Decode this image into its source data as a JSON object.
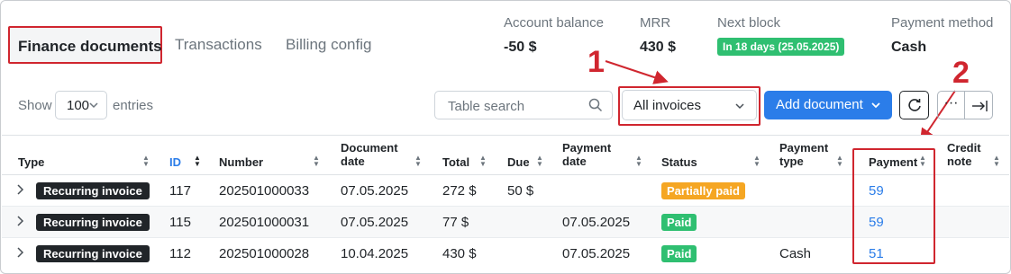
{
  "tabs": [
    {
      "label": "Finance documents",
      "active": true
    },
    {
      "label": "Transactions",
      "active": false
    },
    {
      "label": "Billing config",
      "active": false
    }
  ],
  "summary": {
    "account_balance_label": "Account balance",
    "account_balance_value": "-50 $",
    "mrr_label": "MRR",
    "mrr_value": "430 $",
    "next_block_label": "Next block",
    "next_block_value": "In 18 days (25.05.2025)",
    "payment_method_label": "Payment method",
    "payment_method_value": "Cash"
  },
  "annotations": {
    "one": "1",
    "two": "2"
  },
  "controls": {
    "show_label": "Show",
    "entries_value": "100",
    "entries_label": "entries",
    "search_placeholder": "Table search",
    "filter_value": "All invoices",
    "add_document_label": "Add document",
    "more_label": "···"
  },
  "table": {
    "headers": {
      "type": "Type",
      "id": "ID",
      "number": "Number",
      "document_date_1": "Document",
      "document_date_2": "date",
      "total": "Total",
      "due": "Due",
      "payment_date_1": "Payment",
      "payment_date_2": "date",
      "status": "Status",
      "payment_type_1": "Payment",
      "payment_type_2": "type",
      "payment": "Payment",
      "credit_note_1": "Credit",
      "credit_note_2": "note"
    },
    "rows": [
      {
        "type": "Recurring invoice",
        "id": "117",
        "number": "202501000033",
        "document_date": "07.05.2025",
        "total": "272 $",
        "due": "50 $",
        "payment_date": "",
        "status": "Partially paid",
        "payment_type": "",
        "payment": "59",
        "credit_note": ""
      },
      {
        "type": "Recurring invoice",
        "id": "115",
        "number": "202501000031",
        "document_date": "07.05.2025",
        "total": "77 $",
        "due": "",
        "payment_date": "07.05.2025",
        "status": "Paid",
        "payment_type": "",
        "payment": "59",
        "credit_note": ""
      },
      {
        "type": "Recurring invoice",
        "id": "112",
        "number": "202501000028",
        "document_date": "10.04.2025",
        "total": "430 $",
        "due": "",
        "payment_date": "07.05.2025",
        "status": "Paid",
        "payment_type": "Cash",
        "payment": "51",
        "credit_note": ""
      }
    ]
  },
  "colors": {
    "accent": "#2b7de9",
    "annotation_red": "#d0262f",
    "paid_green": "#2fbf71",
    "partial_orange": "#f5a623",
    "badge_dark": "#212529"
  }
}
